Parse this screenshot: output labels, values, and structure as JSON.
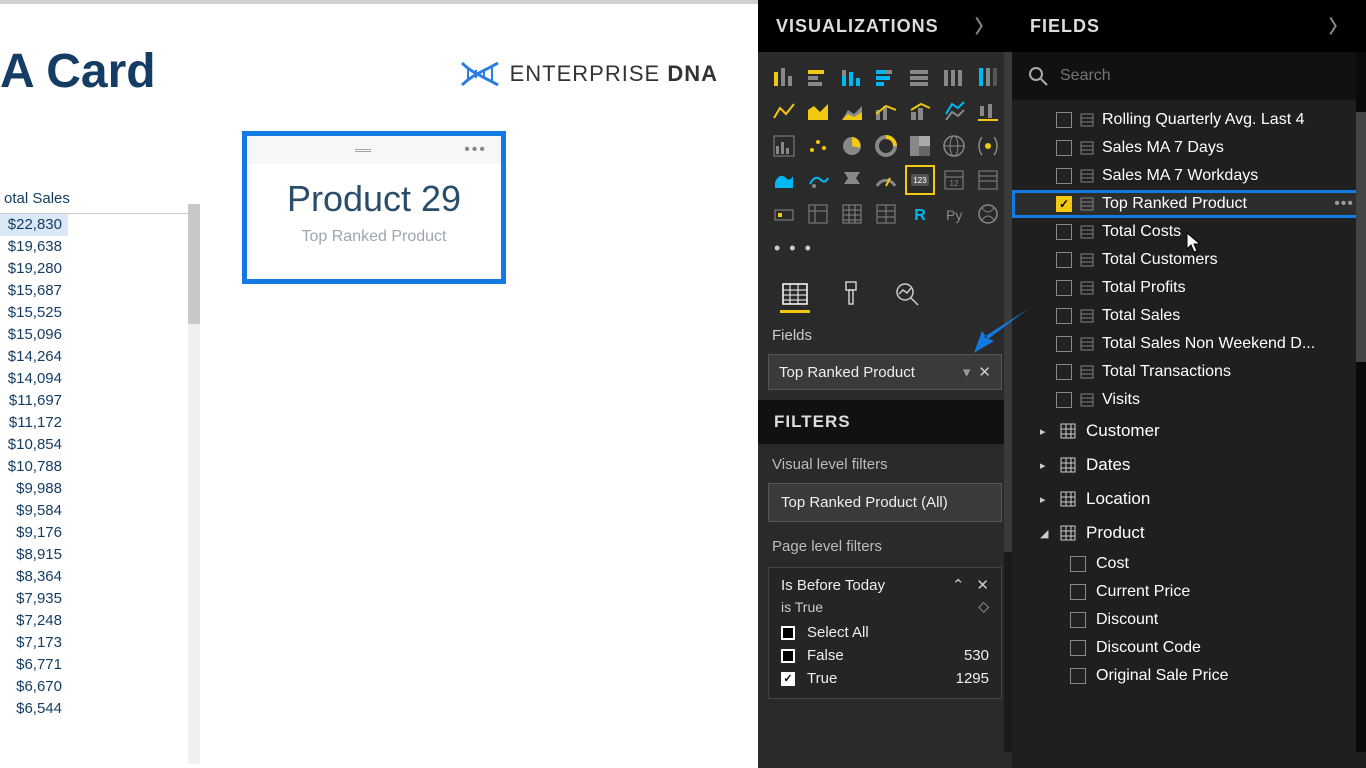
{
  "page": {
    "title": "A Card"
  },
  "logo": {
    "text1": "ENTERPRISE",
    "text2": "DNA"
  },
  "card": {
    "value": "Product 29",
    "label": "Top Ranked Product"
  },
  "sales_table": {
    "header": "otal Sales",
    "rows": [
      "$22,830",
      "$19,638",
      "$19,280",
      "$15,687",
      "$15,525",
      "$15,096",
      "$14,264",
      "$14,094",
      "$11,697",
      "$11,172",
      "$10,854",
      "$10,788",
      "$9,988",
      "$9,584",
      "$9,176",
      "$8,915",
      "$8,364",
      "$7,935",
      "$7,248",
      "$7,173",
      "$6,771",
      "$6,670",
      "$6,544"
    ]
  },
  "viz_panel": {
    "title": "VISUALIZATIONS",
    "more": "• • •",
    "well_label": "Fields",
    "well_item": "Top Ranked Product",
    "filters_title": "FILTERS",
    "visual_filters_label": "Visual level filters",
    "visual_filter_chip": "Top Ranked Product (All)",
    "page_filters_label": "Page level filters",
    "page_filter": {
      "name": "Is Before Today",
      "sub": "is True",
      "opts": [
        {
          "label": "Select All",
          "count": "",
          "checked": false
        },
        {
          "label": "False",
          "count": "530",
          "checked": false
        },
        {
          "label": "True",
          "count": "1295",
          "checked": true
        }
      ]
    }
  },
  "fields_panel": {
    "title": "FIELDS",
    "search_placeholder": "Search",
    "measures": [
      {
        "label": "Rolling Quarterly Avg. Last 4",
        "checked": false
      },
      {
        "label": "Sales MA 7 Days",
        "checked": false
      },
      {
        "label": "Sales MA 7 Workdays",
        "checked": false
      },
      {
        "label": "Top Ranked Product",
        "checked": true,
        "highlighted": true,
        "dots": true
      },
      {
        "label": "Total Costs",
        "checked": false
      },
      {
        "label": "Total Customers",
        "checked": false
      },
      {
        "label": "Total Profits",
        "checked": false
      },
      {
        "label": "Total Sales",
        "checked": false
      },
      {
        "label": "Total Sales Non Weekend D...",
        "checked": false
      },
      {
        "label": "Total Transactions",
        "checked": false
      },
      {
        "label": "Visits",
        "checked": false
      }
    ],
    "tables": [
      {
        "name": "Customer",
        "expanded": false
      },
      {
        "name": "Dates",
        "expanded": false
      },
      {
        "name": "Location",
        "expanded": false
      },
      {
        "name": "Product",
        "expanded": true,
        "fields": [
          "Cost",
          "Current Price",
          "Discount",
          "Discount Code",
          "Original Sale Price"
        ]
      }
    ]
  }
}
